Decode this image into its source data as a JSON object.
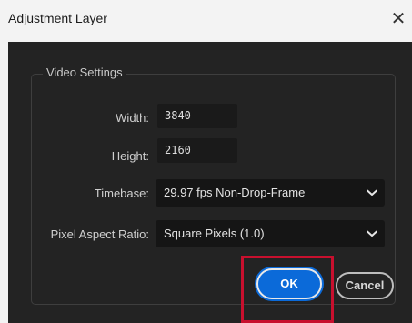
{
  "window": {
    "title": "Adjustment Layer",
    "close_glyph": "✕"
  },
  "video_settings": {
    "legend": "Video Settings",
    "width_label": "Width:",
    "width_value": "3840",
    "height_label": "Height:",
    "height_value": "2160",
    "timebase_label": "Timebase:",
    "timebase_value": "29.97 fps Non-Drop-Frame",
    "par_label": "Pixel Aspect Ratio:",
    "par_value": "Square Pixels (1.0)"
  },
  "buttons": {
    "ok_label": "OK",
    "cancel_label": "Cancel"
  },
  "icons": {
    "close": "close-icon",
    "dropdown": "chevron-down-icon"
  },
  "colors": {
    "dialog_background": "#232323",
    "accent": "#0b6ad9",
    "highlight": "#c8102e"
  }
}
